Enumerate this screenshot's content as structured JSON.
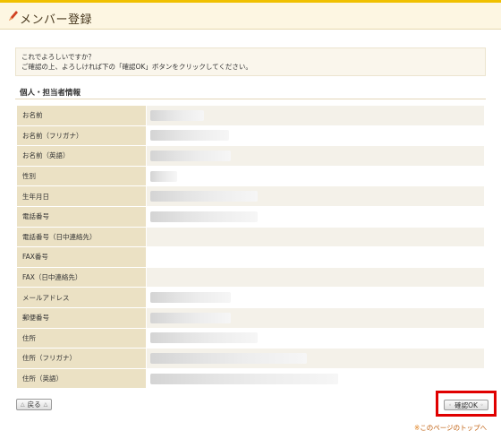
{
  "header": {
    "title": "メンバー登録",
    "icon": "pen-icon"
  },
  "notice": {
    "line1": "これでよろしいですか？",
    "line2": "ご確認の上、よろしければ下の「確認OK」ボタンをクリックしてください。"
  },
  "section": {
    "title": "個人・担当者情報"
  },
  "rows": [
    {
      "label": "お名前"
    },
    {
      "label": "お名前（フリガナ）"
    },
    {
      "label": "お名前（英語）"
    },
    {
      "label": "性別"
    },
    {
      "label": "生年月日"
    },
    {
      "label": "電話番号"
    },
    {
      "label": "電話番号（日中連絡先）"
    },
    {
      "label": "FAX番号"
    },
    {
      "label": "FAX（日中連絡先）"
    },
    {
      "label": "メールアドレス"
    },
    {
      "label": "郵便番号"
    },
    {
      "label": "住所"
    },
    {
      "label": "住所（フリガナ）"
    },
    {
      "label": "住所（英語）"
    }
  ],
  "buttons": {
    "back": "戻る",
    "confirm": "確認OK"
  },
  "footer": {
    "page_top": "このページのトップへ",
    "page_top_mark": "※"
  },
  "colors": {
    "accent": "#f0c000",
    "highlight_border": "#e00000",
    "label_bg": "#ebe1c4"
  }
}
